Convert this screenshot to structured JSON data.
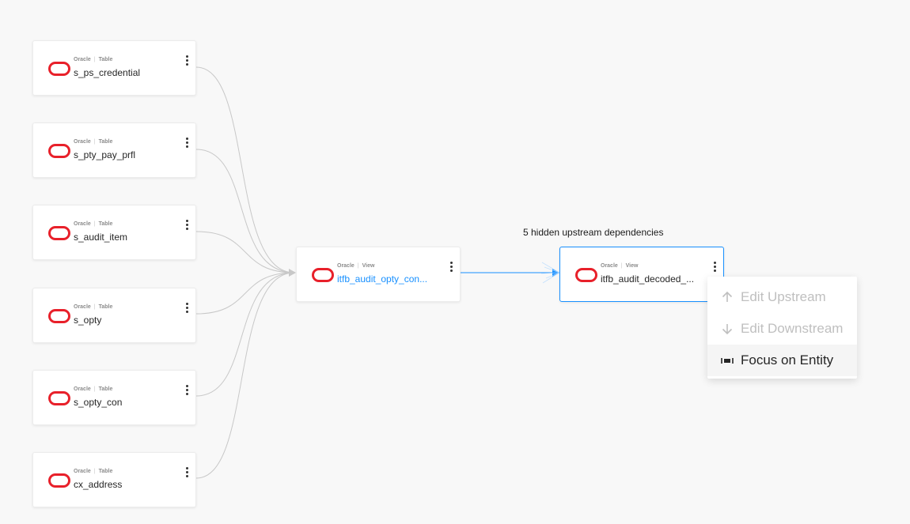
{
  "sources": [
    {
      "platform": "Oracle",
      "type": "Table",
      "name": "s_ps_credential"
    },
    {
      "platform": "Oracle",
      "type": "Table",
      "name": "s_pty_pay_prfl"
    },
    {
      "platform": "Oracle",
      "type": "Table",
      "name": "s_audit_item"
    },
    {
      "platform": "Oracle",
      "type": "Table",
      "name": "s_opty"
    },
    {
      "platform": "Oracle",
      "type": "Table",
      "name": "s_opty_con"
    },
    {
      "platform": "Oracle",
      "type": "Table",
      "name": "cx_address"
    }
  ],
  "middle": {
    "platform": "Oracle",
    "type": "View",
    "name": "itfb_audit_opty_con..."
  },
  "target": {
    "platform": "Oracle",
    "type": "View",
    "name": "itfb_audit_decoded_..."
  },
  "hidden_upstream_label": "5 hidden upstream dependencies",
  "context_menu": {
    "edit_upstream": "Edit Upstream",
    "edit_downstream": "Edit Downstream",
    "focus_entity": "Focus on Entity"
  },
  "colors": {
    "accent": "#1890ff",
    "oracle_red": "#e8202a",
    "edge": "#c8c8c8"
  },
  "icons": {
    "platform_logo": "oracle-logo-icon",
    "menu": "more-vertical-icon",
    "up": "arrow-up-icon",
    "down": "arrow-down-icon",
    "focus": "focus-icon"
  }
}
